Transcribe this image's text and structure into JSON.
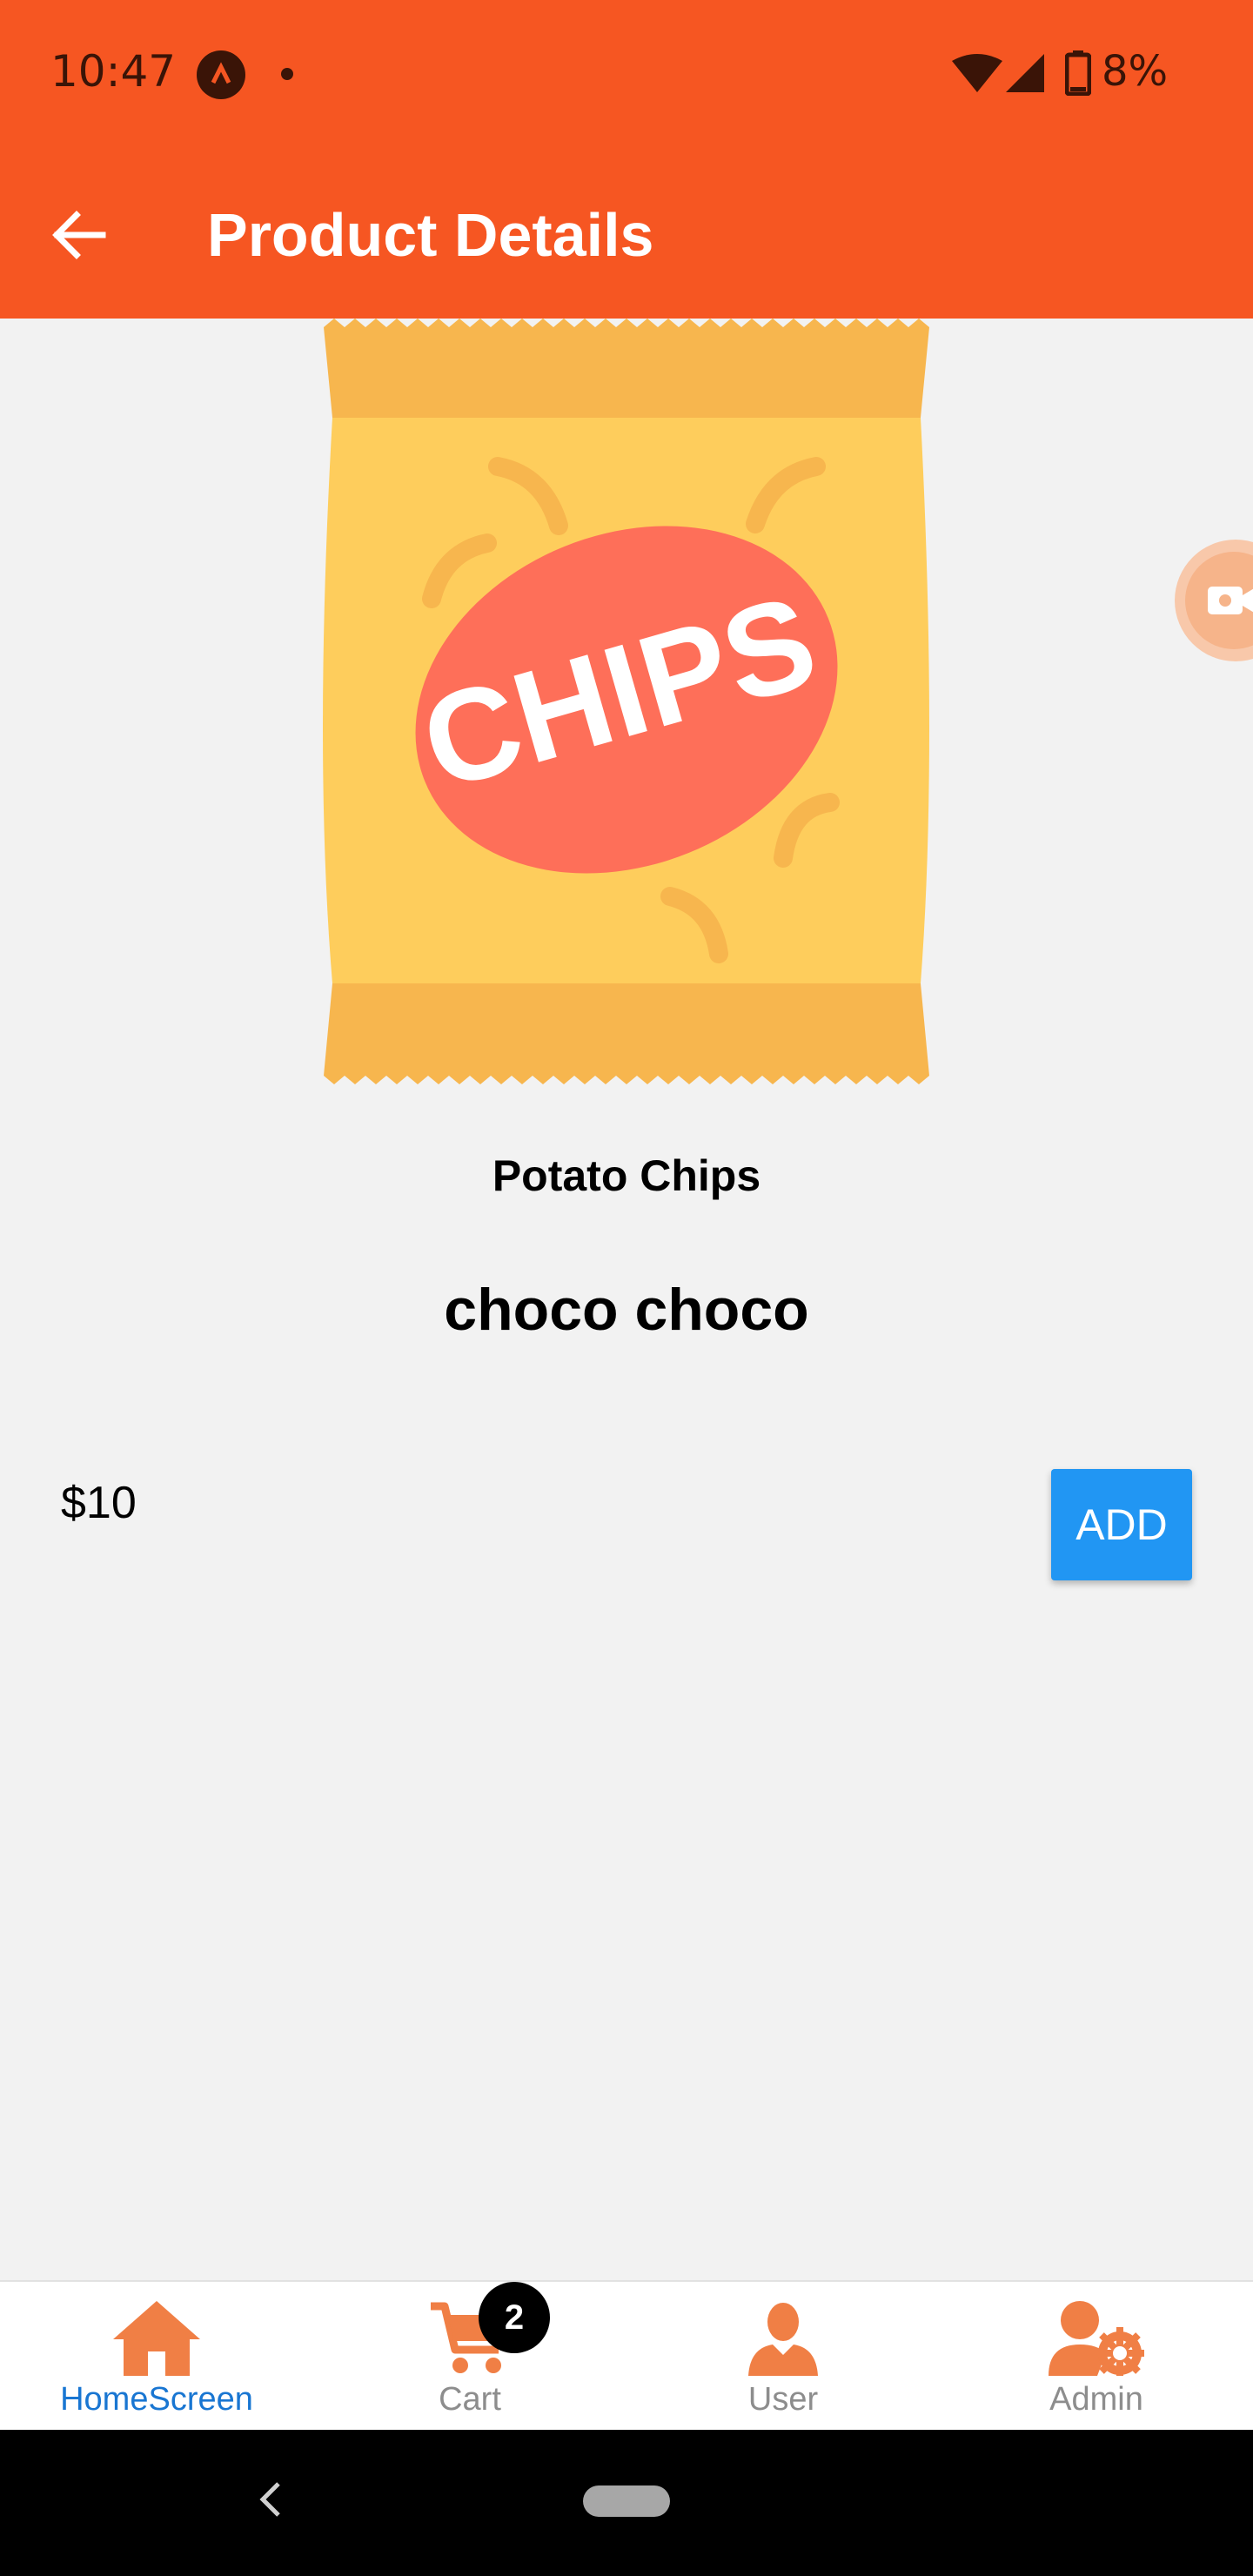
{
  "status_bar": {
    "time": "10:47",
    "battery": "8%"
  },
  "app_bar": {
    "title": "Product Details",
    "back_icon": "arrow-left-icon"
  },
  "product": {
    "image_label": "CHIPS",
    "name": "Potato Chips",
    "description": "choco choco",
    "price": "$10",
    "add_label": "ADD"
  },
  "bottom_nav": {
    "items": [
      {
        "label": "HomeScreen",
        "icon": "home-icon",
        "active": true
      },
      {
        "label": "Cart",
        "icon": "cart-icon",
        "active": false
      },
      {
        "label": "User",
        "icon": "user-icon",
        "active": false
      },
      {
        "label": "Admin",
        "icon": "admin-icon",
        "active": false
      }
    ],
    "cart_count": "2"
  },
  "colors": {
    "primary": "#f65622",
    "accent": "#2196f3",
    "nav_icon": "#f07f45",
    "nav_active": "#1976d2"
  }
}
